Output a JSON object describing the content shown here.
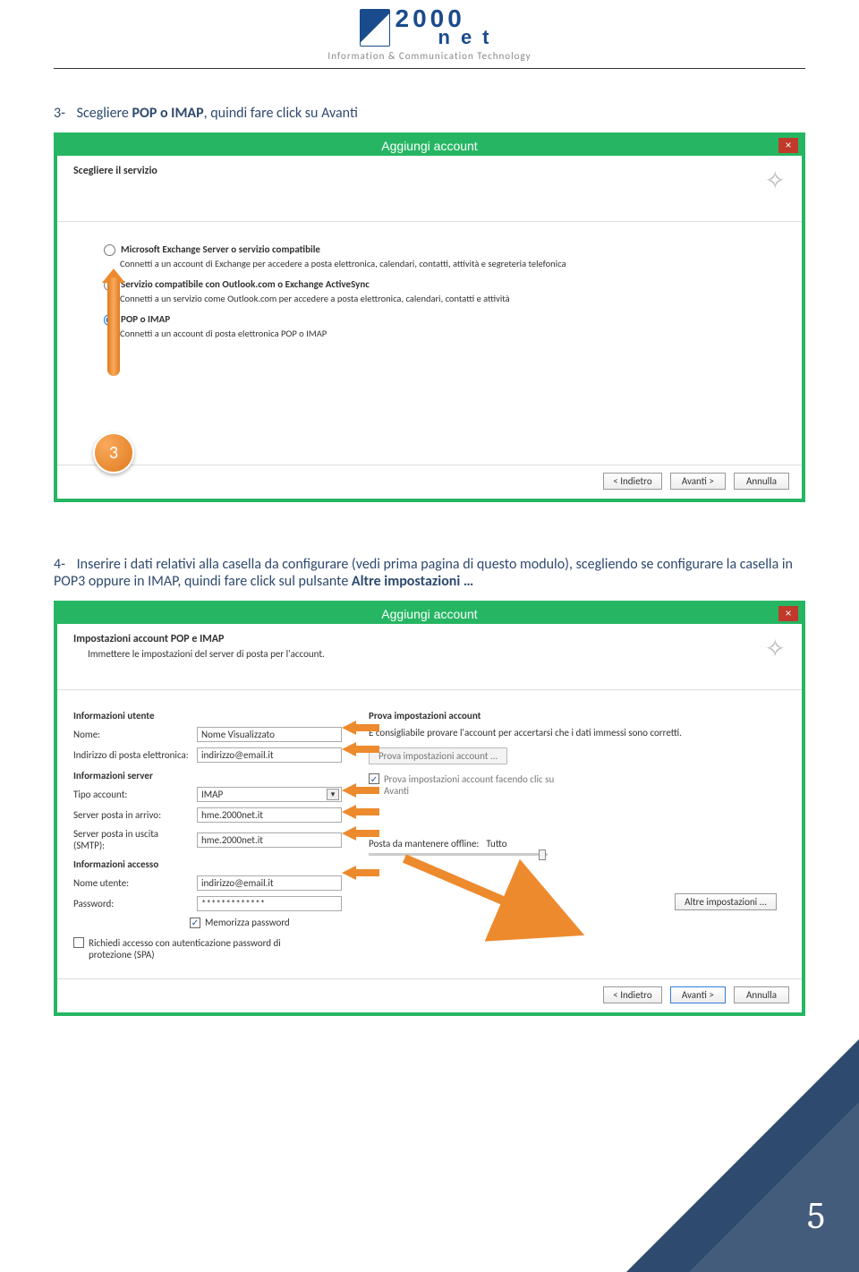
{
  "header": {
    "logo_top": "2000",
    "logo_bottom": "net",
    "tagline": "Information & Communication Technology"
  },
  "step3": {
    "num": "3-",
    "text_a": "Scegliere ",
    "bold": "POP o IMAP",
    "text_b": ", quindi fare click su Avanti"
  },
  "dialog1": {
    "title": "Aggiungi account",
    "head_title": "Scegliere il servizio",
    "options": {
      "opt1_label": "Microsoft Exchange Server o servizio compatibile",
      "opt1_desc": "Connetti a un account di Exchange per accedere a posta elettronica, calendari, contatti, attività e segreteria telefonica",
      "opt2_label": "Servizio compatibile con Outlook.com o Exchange ActiveSync",
      "opt2_desc": "Connetti a un servizio come Outlook.com per accedere a posta elettronica, calendari, contatti e attività",
      "opt3_label": "POP o IMAP",
      "opt3_desc": "Connetti a un account di posta elettronica POP o IMAP"
    },
    "callout": "3",
    "buttons": {
      "back": "< Indietro",
      "next": "Avanti >",
      "cancel": "Annulla"
    }
  },
  "step4": {
    "num": "4-",
    "text_a": "Inserire i dati relativi alla casella da configurare (vedi prima pagina di questo modulo), scegliendo se configurare la casella in POP3 oppure in IMAP, quindi fare click sul pulsante ",
    "bold": "Altre impostazioni …"
  },
  "dialog2": {
    "title": "Aggiungi account",
    "head_title": "Impostazioni account POP e IMAP",
    "head_sub": "Immettere le impostazioni del server di posta per l'account.",
    "left": {
      "sec_user": "Informazioni utente",
      "name_label": "Nome:",
      "name_value": "Nome Visualizzato",
      "email_label": "Indirizzo di posta elettronica:",
      "email_value": "indirizzo@email.it",
      "sec_server": "Informazioni server",
      "type_label": "Tipo account:",
      "type_value": "IMAP",
      "in_label": "Server posta in arrivo:",
      "in_value": "hme.2000net.it",
      "out_label": "Server posta in uscita (SMTP):",
      "out_value": "hme.2000net.it",
      "sec_access": "Informazioni accesso",
      "user_label": "Nome utente:",
      "user_value": "indirizzo@email.it",
      "pass_label": "Password:",
      "pass_value": "*************",
      "remember": "Memorizza password",
      "spa": "Richiedi accesso con autenticazione password di protezione (SPA)"
    },
    "right": {
      "sec_test": "Prova impostazioni account",
      "advice": "È consigliabile provare l'account per accertarsi che i dati immessi sono corretti.",
      "test_btn": "Prova impostazioni account ...",
      "auto_test": "Prova impostazioni account facendo clic su Avanti",
      "offline_label": "Posta da mantenere offline:",
      "offline_value": "Tutto",
      "more_btn": "Altre impostazioni ..."
    },
    "buttons": {
      "back": "< Indietro",
      "next": "Avanti >",
      "cancel": "Annulla"
    }
  },
  "page_number": "5"
}
